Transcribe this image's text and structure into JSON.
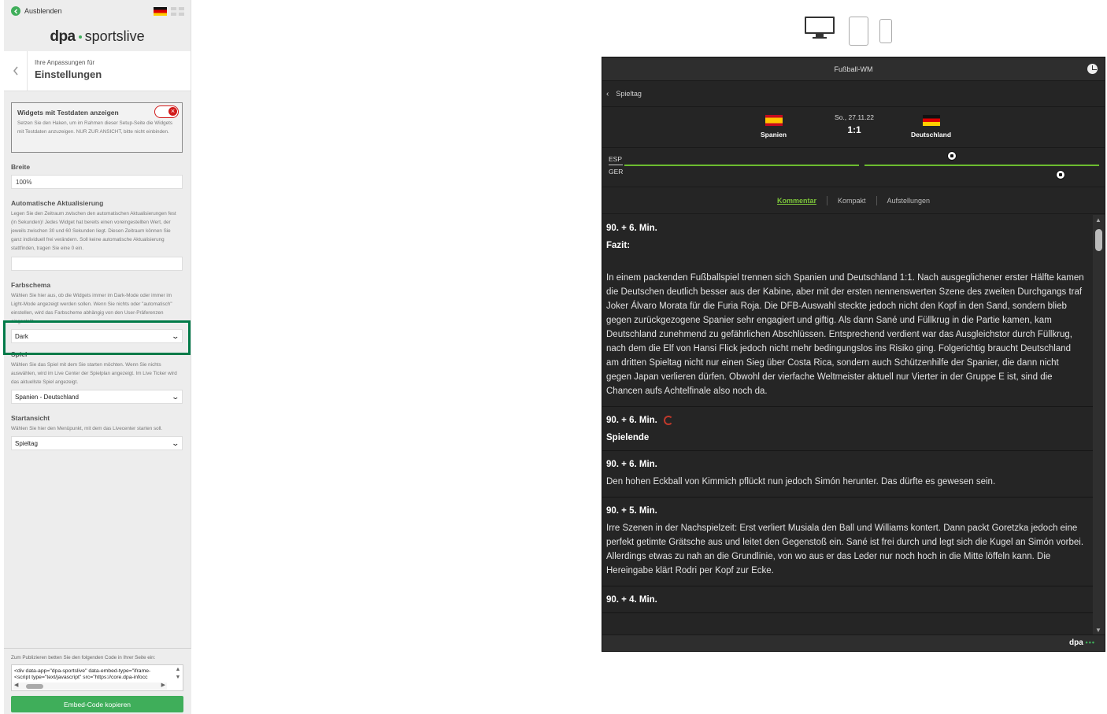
{
  "panel": {
    "hide_label": "Ausblenden",
    "logo": {
      "dpa": "dpa",
      "product": "sportslive"
    },
    "header": {
      "sub": "Ihre Anpassungen für",
      "title": "Einstellungen"
    },
    "testdata": {
      "label": "Widgets mit Testdaten anzeigen",
      "hint": "Setzen Sie den Haken, um im Rahmen dieser Setup-Seite die Widgets mit Testdaten anzuzeigen. NUR ZUR ANSICHT, bitte nicht einbinden.",
      "enabled": false
    },
    "width": {
      "label": "Breite",
      "value": "100%"
    },
    "refresh": {
      "label": "Automatische Aktualisierung",
      "hint": "Legen Sie den Zeitraum zwischen den automatischen Aktualisierungen fest (in Sekunden)! Jedes Widget hat bereits einen voreingestellten Wert, der jeweils zwischen 30 und 60 Sekunden liegt. Diesen Zeitraum können Sie ganz individuell frei verändern. Soll keine automatische Aktualisierung stattfinden, tragen Sie eine 0 ein.",
      "value": ""
    },
    "scheme": {
      "label": "Farbschema",
      "hint": "Wählen Sie hier aus, ob die Widgets immer im Dark-Mode oder immer im Light-Mode angezeigt werden sollen. Wenn Sie nichts oder \"automatisch\" einstellen, wird das Farbscheme abhängig von den User-Präferenzen eingestellt.",
      "value": "Dark"
    },
    "game": {
      "label": "Spiel",
      "hint": "Wählen Sie das Spiel mit dem Sie starten möchten. Wenn Sie nichts auswählen, wird im Live Center der Spielplan angezeigt. Im Live Ticker wird das aktuellste Spiel angezeigt.",
      "value": "Spanien - Deutschland"
    },
    "start": {
      "label": "Startansicht",
      "hint": "Wählen Sie hier den Menüpunkt, mit dem das Livecenter starten soll.",
      "value": "Spieltag"
    },
    "footer": {
      "note": "Zum Publizieren betten Sie den folgenden Code in Ihrer Seite ein:",
      "code_line1": "<div data-app=\"dpa-sportslive\" data-embed-type=\"iframe-",
      "code_line2": "<script type=\"text/javascript\" src=\"https://core.dpa-infocc",
      "copy_label": "Embed-Code kopieren"
    }
  },
  "devices": [
    "desktop-icon",
    "tablet-icon",
    "phone-icon"
  ],
  "widget": {
    "title": "Fußball-WM",
    "nav_label": "Spieltag",
    "match": {
      "home": "Spanien",
      "away": "Deutschland",
      "date": "So., 27.11.22",
      "score": "1:1"
    },
    "timeline": {
      "home_code": "ESP",
      "away_code": "GER"
    },
    "tabs": [
      "Kommentar",
      "Kompakt",
      "Aufstellungen"
    ],
    "active_tab": "Kommentar",
    "entries": [
      {
        "minute": "90. + 6. Min.",
        "headline": "Fazit:",
        "text": "In einem packenden Fußballspiel trennen sich Spanien und Deutschland 1:1. Nach ausgeglichener erster Hälfte kamen die Deutschen deutlich besser aus der Kabine, aber mit der ersten nennenswerten Szene des zweiten Durchgangs traf Joker Álvaro Morata für die Furia Roja. Die DFB-Auswahl steckte jedoch nicht den Kopf in den Sand, sondern blieb gegen zurückgezogene Spanier sehr engagiert und giftig. Als dann Sané und Füllkrug in die Partie kamen, kam Deutschland zunehmend zu gefährlichen Abschlüssen. Entsprechend verdient war das Ausgleichstor durch Füllkrug, nach dem die Elf von Hansi Flick jedoch nicht mehr bedingungslos ins Risiko ging. Folgerichtig braucht Deutschland am dritten Spieltag nicht nur einen Sieg über Costa Rica, sondern auch Schützenhilfe der Spanier, die dann nicht gegen Japan verlieren dürfen. Obwohl der vierfache Weltmeister aktuell nur Vierter in der Gruppe E ist, sind die Chancen aufs Achtelfinale also noch da."
      },
      {
        "minute": "90. + 6. Min.",
        "headline": "Spielende"
      },
      {
        "minute": "90. + 6. Min.",
        "text": "Den hohen Eckball von Kimmich pflückt nun jedoch Simón herunter. Das dürfte es gewesen sein."
      },
      {
        "minute": "90. + 5. Min.",
        "text": "Irre Szenen in der Nachspielzeit: Erst verliert Musiala den Ball und Williams kontert. Dann packt Goretzka jedoch eine perfekt getimte Grätsche aus und leitet den Gegenstoß ein. Sané ist frei durch und legt sich die Kugel an Simón vorbei. Allerdings etwas zu nah an die Grundlinie, von wo aus er das Leder nur noch hoch in die Mitte löffeln kann. Die Hereingabe klärt Rodri per Kopf zur Ecke."
      },
      {
        "minute": "90. + 4. Min."
      }
    ],
    "footer_brand": "dpa"
  },
  "colors": {
    "accent": "#3fae5a",
    "highlight": "#007a48",
    "active_tab": "#7cc43a",
    "widget_bg": "#252525"
  }
}
